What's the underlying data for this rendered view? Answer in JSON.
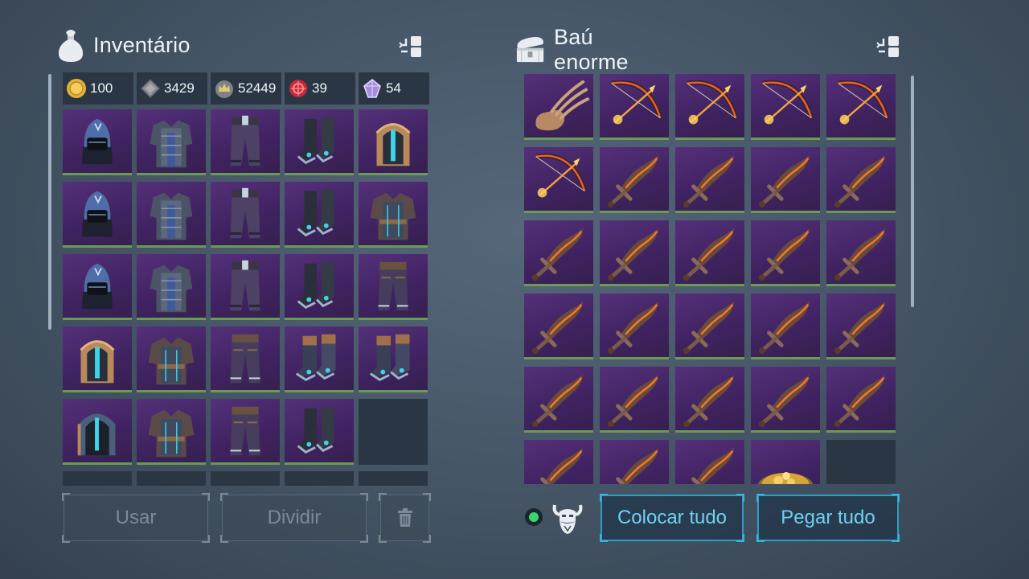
{
  "inventory": {
    "title": "Inventário",
    "currencies": [
      {
        "icon": "gold-coin-icon",
        "value": "100",
        "color": "#e8b23a"
      },
      {
        "icon": "iron-ore-icon",
        "value": "3429",
        "color": "#8b8f94"
      },
      {
        "icon": "crown-token-icon",
        "value": "52449",
        "color": "#c9b26a"
      },
      {
        "icon": "red-emblem-icon",
        "value": "39",
        "color": "#c8283a"
      },
      {
        "icon": "purple-crystal-icon",
        "value": "54",
        "color": "#a78de0"
      }
    ],
    "items": [
      [
        "blue-hood-helmet-icon",
        "chain-chest-armor-icon",
        "purple-pants-icon",
        "steel-boots-icon",
        "bronze-visor-helmet-icon"
      ],
      [
        "blue-hood-helmet-icon",
        "chain-chest-armor-icon",
        "purple-pants-icon",
        "steel-boots-icon",
        "leather-chest-armor-icon"
      ],
      [
        "blue-hood-helmet-icon",
        "chain-chest-armor-icon",
        "purple-pants-icon",
        "steel-boots-icon",
        "leather-pants-icon"
      ],
      [
        "bronze-visor-helmet-icon",
        "leather-chest-armor-icon",
        "leather-pants-icon",
        "bronze-boots-icon",
        "bronze-boots-icon"
      ],
      [
        "dark-visor-helmet-icon",
        "leather-chest-armor-icon",
        "leather-pants-icon",
        "steel-boots-icon",
        "empty"
      ]
    ],
    "buttons": {
      "use": "Usar",
      "split": "Dividir",
      "discard_icon": "trash-icon"
    }
  },
  "chest": {
    "title": "Baú enorme",
    "items": [
      [
        "claw-gauntlet-icon",
        "fire-bow-icon",
        "fire-bow-icon",
        "fire-bow-icon",
        "fire-bow-icon"
      ],
      [
        "fire-bow-icon",
        "fire-sword-icon",
        "fire-sword-icon",
        "fire-sword-icon",
        "fire-sword-icon"
      ],
      [
        "fire-sword-icon",
        "fire-sword-icon",
        "fire-sword-icon",
        "fire-sword-icon",
        "fire-sword-icon"
      ],
      [
        "fire-sword-icon",
        "fire-sword-icon",
        "fire-sword-icon",
        "fire-sword-icon",
        "fire-sword-icon"
      ],
      [
        "fire-sword-icon",
        "fire-sword-icon",
        "fire-sword-icon",
        "fire-sword-icon",
        "fire-sword-icon"
      ],
      [
        "fire-sword-icon",
        "fire-sword-icon",
        "fire-sword-icon",
        "gold-pile-icon",
        "empty"
      ]
    ],
    "buttons": {
      "put_all": "Colocar tudo",
      "take_all": "Pegar tudo"
    },
    "owner_icon": "viking-mask-icon",
    "status_color": "#35d86a"
  }
}
